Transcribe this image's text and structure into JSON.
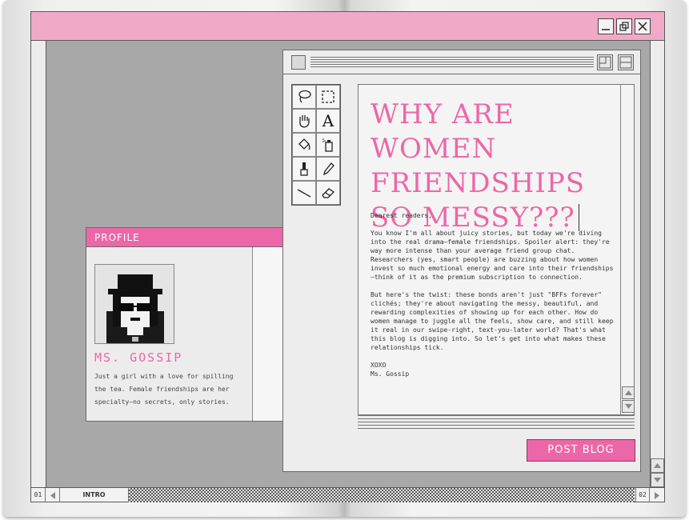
{
  "window": {
    "controls": [
      "minimize",
      "restore",
      "close"
    ]
  },
  "profile": {
    "header": "PROFILE",
    "name": "MS. GOSSIP",
    "bio": "Just a girl with a love for spilling the tea. Female friendships are her specialty—no secrets, only stories."
  },
  "post": {
    "title": "WHY ARE WOMEN FRIENDSHIPS SO MESSY???",
    "greeting": "Dearest readers,",
    "paragraph1": "You know I'm all about juicy stories, but today we're diving into the real drama—female friendships. Spoiler alert: they're way more intense than your average friend group chat. Researchers (yes, smart people) are buzzing about how women invest so much emotional energy and care into their friendships—think of it as the premium subscription to connection.",
    "paragraph2": "But here's the twist: these bonds aren't just \"BFFs forever\" clichés; they're about navigating the messy, beautiful, and rewarding complexities of showing up for each other. How do women manage to juggle all the feels, show care, and still keep it real in our swipe-right, text-you-later world? That's what this blog is digging into. So let's get into what makes these relationships tick.",
    "signoff": "XOXO",
    "signature": "Ms. Gossip",
    "post_button": "POST BLOG"
  },
  "tools": [
    "lasso-icon",
    "marquee-select-icon",
    "hand-icon",
    "text-tool-icon",
    "paint-bucket-icon",
    "spray-can-icon",
    "brush-icon",
    "pencil-icon",
    "line-tool-icon",
    "eraser-icon"
  ],
  "text_tool_glyph": "A",
  "footer": {
    "page_left": "01",
    "tab": "INTRO",
    "page_right": "02"
  },
  "colors": {
    "accent_pink": "#ec67a7",
    "titlebar_pink": "#f0a9c6"
  }
}
